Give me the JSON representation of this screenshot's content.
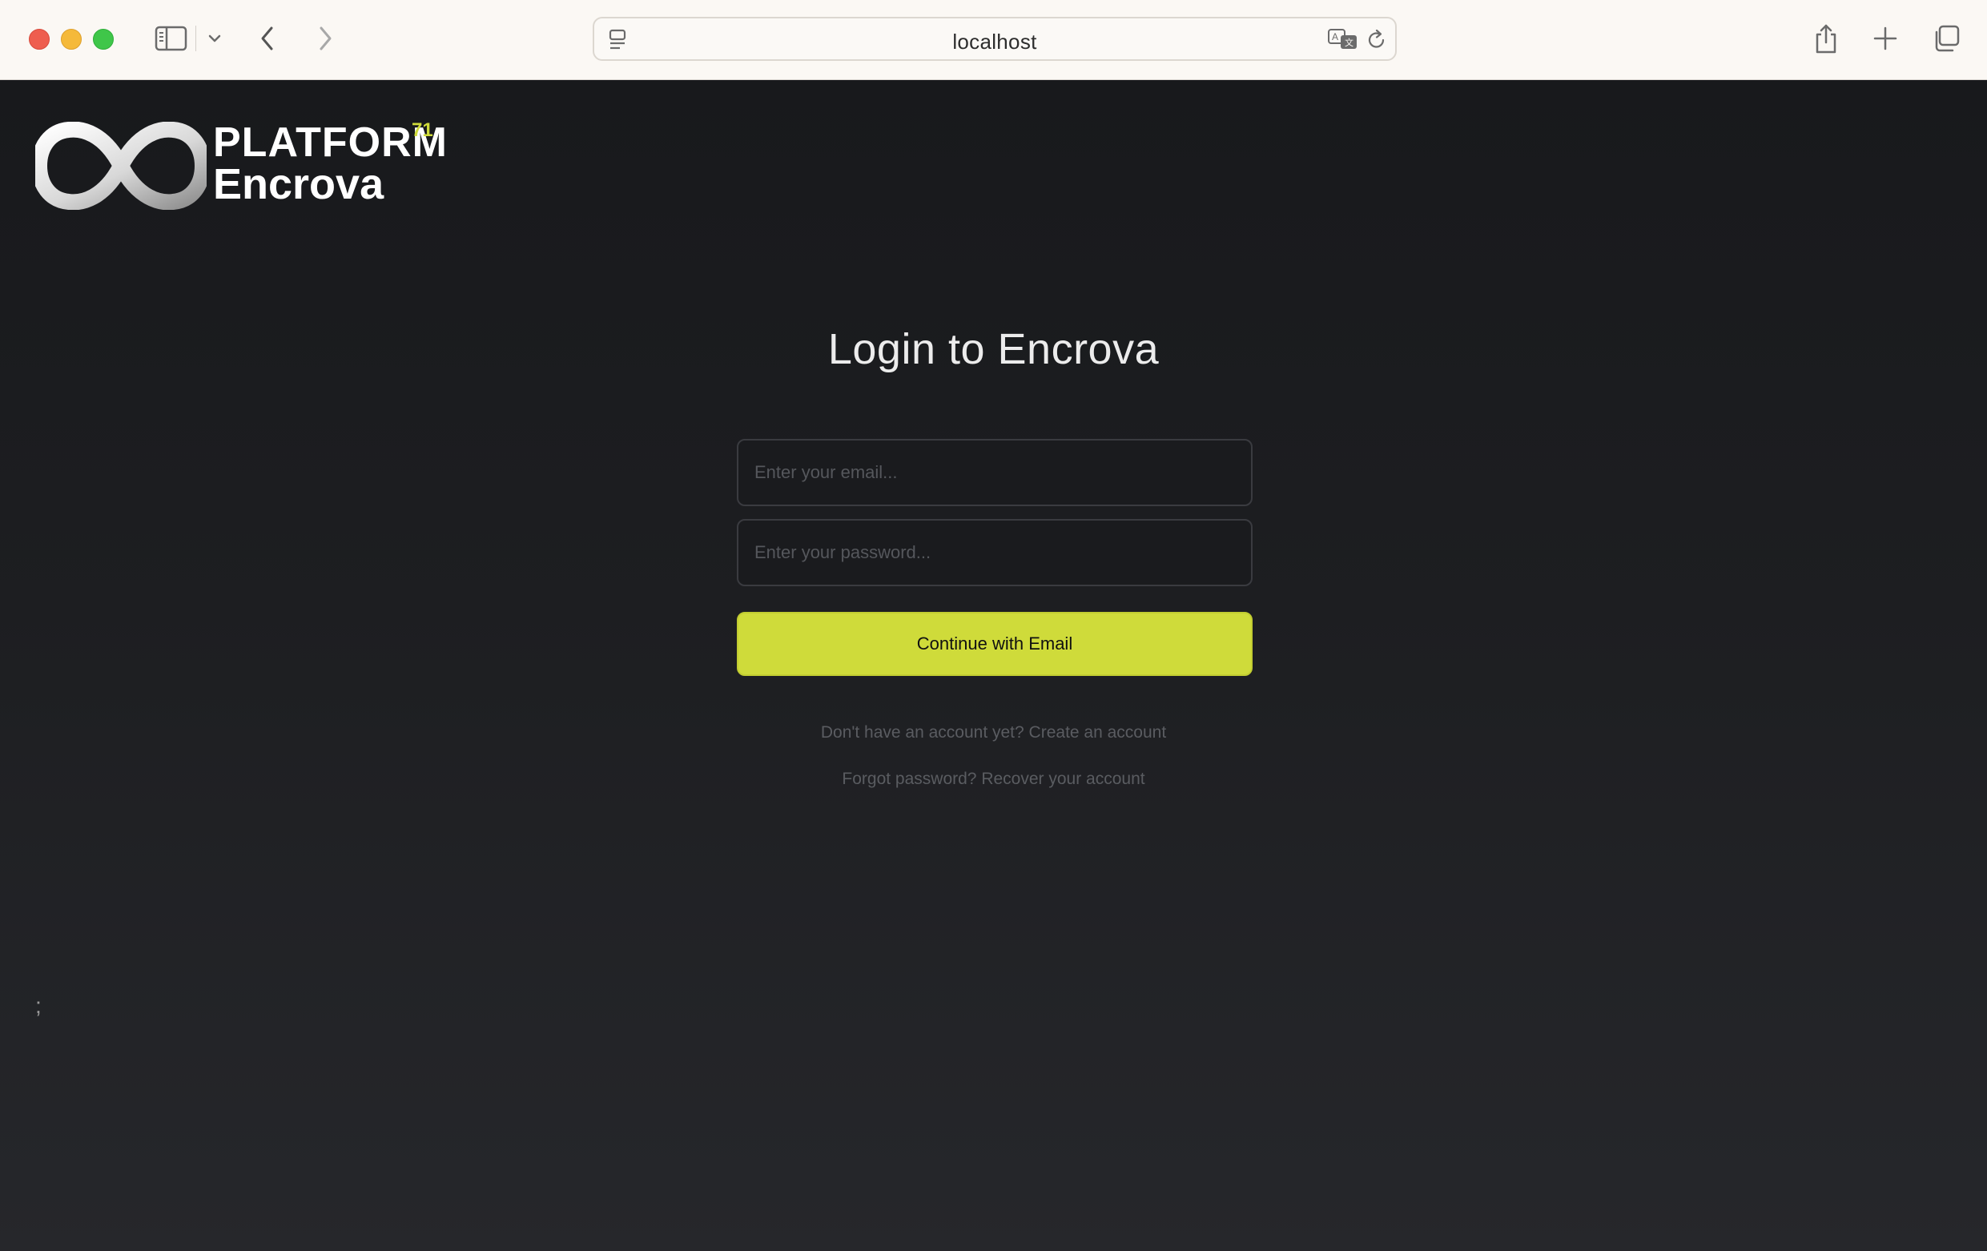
{
  "browser": {
    "url": "localhost",
    "icons": {
      "sidebar": "sidebar-icon",
      "chevron": "chevron-down-icon",
      "back": "back-arrow-icon",
      "forward": "forward-arrow-icon",
      "site": "site-settings-icon",
      "translate": "translate-icon",
      "reload": "reload-icon",
      "share": "share-icon",
      "new_tab": "plus-icon",
      "tabs": "tab-overview-icon"
    }
  },
  "logo": {
    "platform": "PLATFORM",
    "superscript": "71",
    "brand": "Encrova"
  },
  "login": {
    "title": "Login to Encrova",
    "email_placeholder": "Enter your email...",
    "password_placeholder": "Enter your password...",
    "continue_label": "Continue with Email",
    "signup_prompt": "Don't have an account yet?",
    "signup_link": "Create an account",
    "forgot_prompt": "Forgot password?",
    "forgot_link": "Recover your account"
  },
  "stray_text": ";",
  "colors": {
    "accent": "#cfdb3a",
    "background": "#1b1c1f",
    "chrome": "#fbf8f4"
  }
}
